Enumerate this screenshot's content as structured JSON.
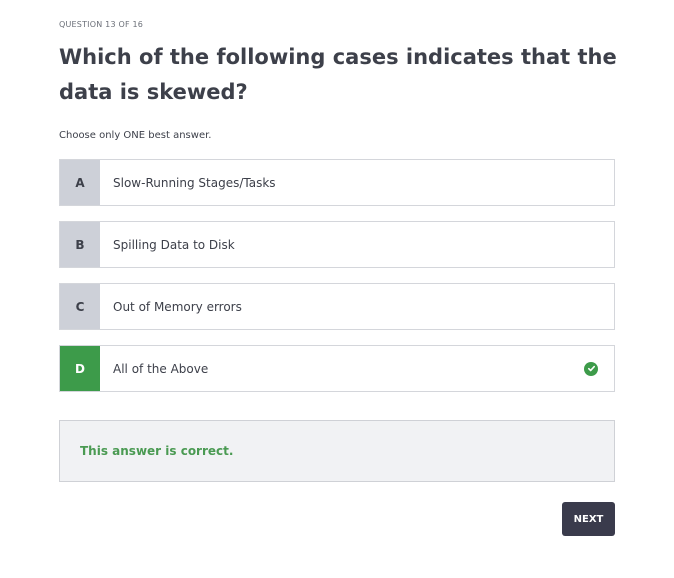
{
  "quiz": {
    "counter": "QUESTION 13 OF 16",
    "question": "Which of the following cases indicates that the data is skewed?",
    "instruction": "Choose only ONE best answer.",
    "options": [
      {
        "letter": "A",
        "text": "Slow-Running Stages/Tasks",
        "state": "default"
      },
      {
        "letter": "B",
        "text": "Spilling Data to Disk",
        "state": "default"
      },
      {
        "letter": "C",
        "text": "Out of Memory errors",
        "state": "default"
      },
      {
        "letter": "D",
        "text": "All of the Above",
        "state": "correct",
        "icon": "check-circle-icon"
      }
    ],
    "feedback": "This answer is correct.",
    "next_label": "NEXT"
  },
  "colors": {
    "correct": "#3d9b4a",
    "letter_bg": "#cdd0d8",
    "next_button": "#3a3b4c",
    "feedback_text": "#4a9a52"
  }
}
